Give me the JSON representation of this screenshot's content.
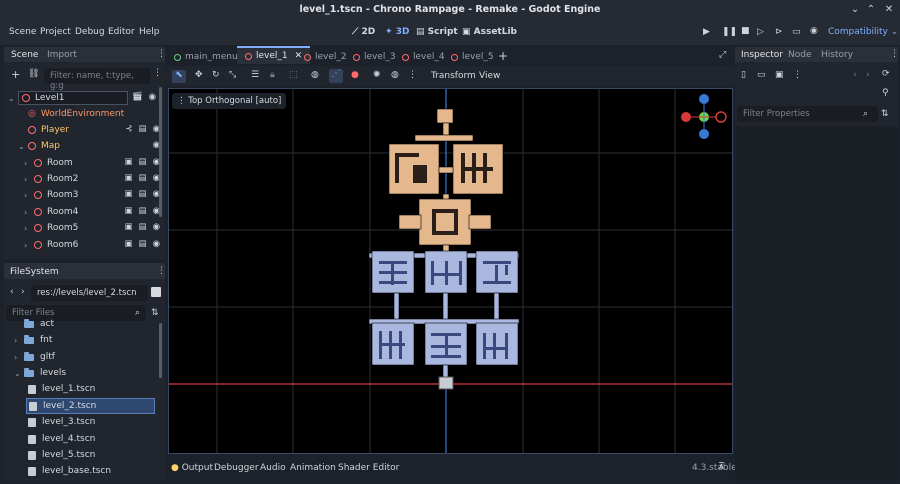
{
  "window": {
    "title": "level_1.tscn - Chrono Rampage - Remake - Godot Engine"
  },
  "menu": [
    "Scene",
    "Project",
    "Debug",
    "Editor",
    "Help"
  ],
  "workspaces": {
    "w2d": "2D",
    "w3d": "3D",
    "script": "Script",
    "assetlib": "AssetLib"
  },
  "renderer": "Compatibility",
  "scene_dock": {
    "tabs": [
      "Scene",
      "Import"
    ],
    "filter_placeholder": "Filter: name, t:type, g:g",
    "nodes": [
      {
        "label": "Level1",
        "depth": 0
      },
      {
        "label": "WorldEnvironment",
        "depth": 1
      },
      {
        "label": "Player",
        "depth": 1
      },
      {
        "label": "Map",
        "depth": 1
      },
      {
        "label": "Room",
        "depth": 2
      },
      {
        "label": "Room2",
        "depth": 2
      },
      {
        "label": "Room3",
        "depth": 2
      },
      {
        "label": "Room4",
        "depth": 2
      },
      {
        "label": "Room5",
        "depth": 2
      },
      {
        "label": "Room6",
        "depth": 2
      }
    ]
  },
  "filesystem": {
    "title": "FileSystem",
    "path": "res://levels/level_2.tscn",
    "filter_placeholder": "Filter Files",
    "items": [
      {
        "label": "act",
        "kind": "folder",
        "depth": 1
      },
      {
        "label": "fnt",
        "kind": "folder",
        "depth": 1
      },
      {
        "label": "gltf",
        "kind": "folder",
        "depth": 1
      },
      {
        "label": "levels",
        "kind": "folder",
        "depth": 1
      },
      {
        "label": "level_1.tscn",
        "kind": "file",
        "depth": 2
      },
      {
        "label": "level_2.tscn",
        "kind": "file",
        "depth": 2
      },
      {
        "label": "level_3.tscn",
        "kind": "file",
        "depth": 2
      },
      {
        "label": "level_4.tscn",
        "kind": "file",
        "depth": 2
      },
      {
        "label": "level_5.tscn",
        "kind": "file",
        "depth": 2
      },
      {
        "label": "level_base.tscn",
        "kind": "file",
        "depth": 2
      }
    ]
  },
  "editor_tabs": [
    "main_menu",
    "level_1",
    "level_2",
    "level_3",
    "level_4",
    "level_5"
  ],
  "viewport_toolbar": {
    "transform": "Transform",
    "view": "View"
  },
  "viewport": {
    "label": "Top Orthogonal [auto]"
  },
  "inspector": {
    "tabs": [
      "Inspector",
      "Node",
      "History"
    ],
    "filter_placeholder": "Filter Properties"
  },
  "bottom": {
    "tabs": [
      "Output",
      "Debugger",
      "Audio",
      "Animation",
      "Shader Editor"
    ],
    "version": "4.3.stable"
  },
  "colors": {
    "accent": "#7fb0ff",
    "node_red": "#ff6b6b",
    "tan": "#e4b88c",
    "blue_room": "#aab8e0"
  }
}
